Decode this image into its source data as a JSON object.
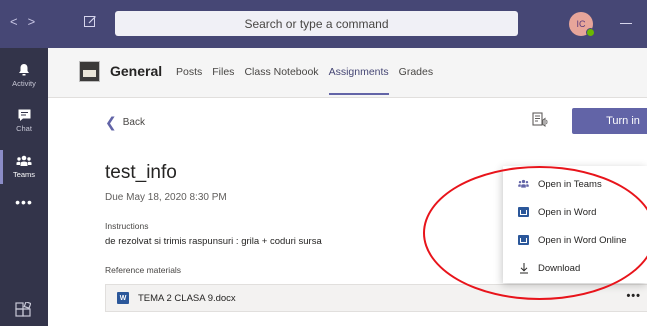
{
  "topbar": {
    "search_placeholder": "Search or type a command",
    "avatar_initials": "IC",
    "presence_status": "available",
    "icons": [
      "back-arrow-icon",
      "forward-arrow-icon",
      "compose-icon",
      "minimize-icon"
    ]
  },
  "rail": {
    "items": [
      {
        "label": "Activity",
        "icon": "bell-icon"
      },
      {
        "label": "Chat",
        "icon": "chat-icon"
      },
      {
        "label": "Teams",
        "icon": "teams-icon",
        "active": true
      }
    ],
    "more_label": "•••"
  },
  "channel": {
    "name": "General",
    "tabs": [
      {
        "label": "Posts"
      },
      {
        "label": "Files"
      },
      {
        "label": "Class Notebook"
      },
      {
        "label": "Assignments",
        "active": true
      },
      {
        "label": "Grades"
      }
    ]
  },
  "assignment": {
    "back_label": "Back",
    "turn_in_label": "Turn in",
    "title": "test_info",
    "due": "Due May 18, 2020 8:30 PM",
    "instructions_label": "Instructions",
    "instructions_text": "de rezolvat si trimis raspunsuri : grila +  coduri sursa",
    "reference_label": "Reference materials",
    "file_name": "TEMA 2 CLASA 9.docx",
    "file_more": "•••"
  },
  "context_menu": {
    "items": [
      {
        "label": "Open in Teams",
        "icon": "teams-icon"
      },
      {
        "label": "Open in Word",
        "icon": "word-icon"
      },
      {
        "label": "Open in Word Online",
        "icon": "word-icon"
      },
      {
        "label": "Download",
        "icon": "download-icon"
      }
    ]
  },
  "colors": {
    "topbar": "#464775",
    "rail": "#33344a",
    "accent": "#6264a7",
    "annotation": "#e8141b"
  }
}
